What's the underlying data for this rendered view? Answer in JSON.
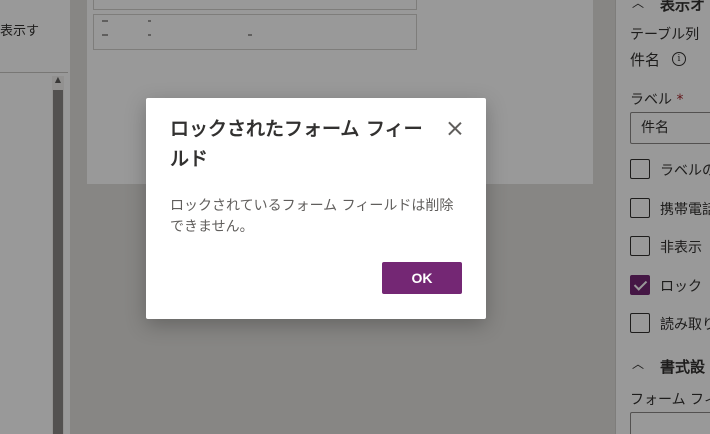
{
  "left_panel": {
    "show_label": "表示す"
  },
  "right_panel": {
    "section_display": "表示オ",
    "table_column_label": "テーブル列",
    "table_column_value": "件名",
    "label_heading": "ラベル",
    "required_mark": "*",
    "label_value": "件名",
    "options": [
      {
        "label": "ラベルの",
        "checked": false
      },
      {
        "label": "携帯電話",
        "checked": false
      },
      {
        "label": "非表示",
        "checked": false
      },
      {
        "label": "ロック",
        "checked": true
      },
      {
        "label": "読み取り",
        "checked": false
      }
    ],
    "section_format": "書式設",
    "form_field_label": "フォーム フィ"
  },
  "dialog": {
    "title": "ロックされたフォーム フィールド",
    "message": "ロックされているフォーム フィールドは削除できません。",
    "ok_label": "OK"
  },
  "colors": {
    "accent": "#742774",
    "overlay": "rgba(0,0,0,0.4)"
  }
}
